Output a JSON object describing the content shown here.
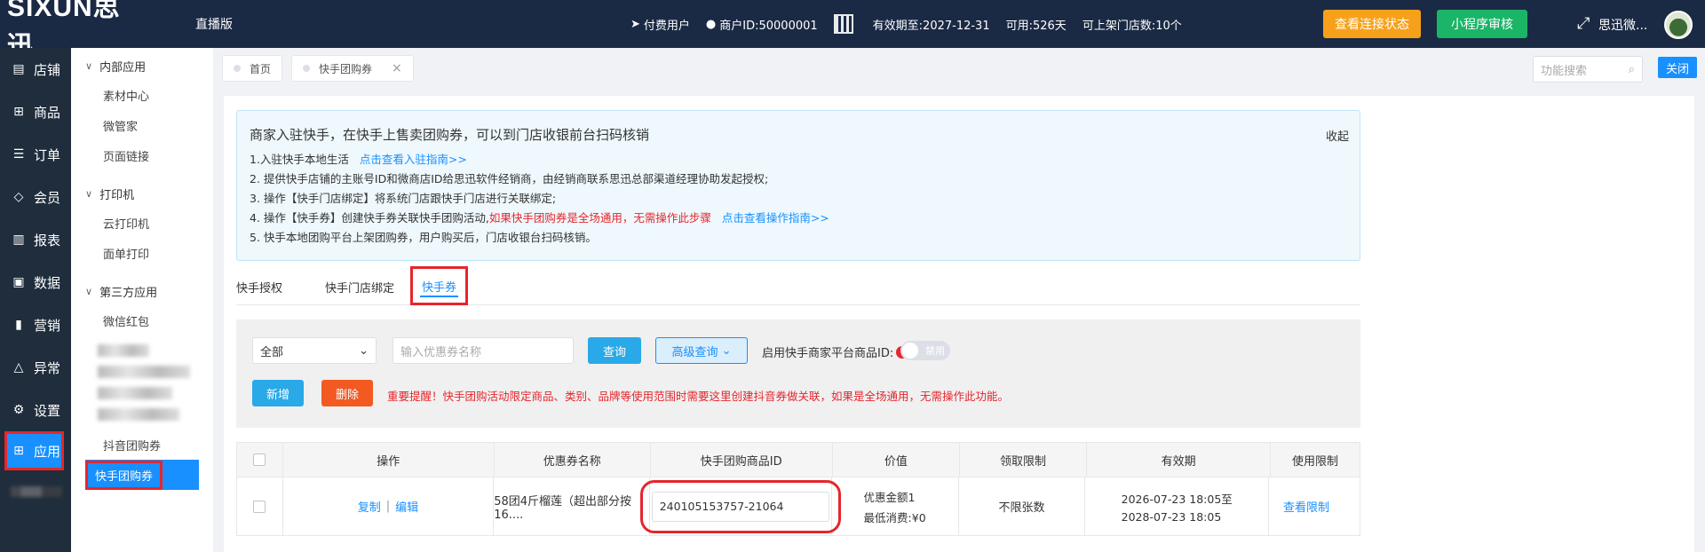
{
  "topbar": {
    "logo": "SIXUN思迅",
    "edition": "直播版",
    "paid_user": "付费用户",
    "merchant_id": "商户ID:50000001",
    "valid_until": "有效期至:2027-12-31",
    "available": "可用:526天",
    "store_count": "可上架门店数:10个",
    "check_status_btn": "查看连接状态",
    "miniapp_btn": "小程序审核",
    "user_name": "思迅微...",
    "accent_orange": "#f7a11a",
    "accent_green": "#1bb567"
  },
  "nav": {
    "items": [
      {
        "label": "店铺",
        "icon": "store-icon"
      },
      {
        "label": "商品",
        "icon": "gift-icon"
      },
      {
        "label": "订单",
        "icon": "order-icon"
      },
      {
        "label": "会员",
        "icon": "diamond-icon"
      },
      {
        "label": "报表",
        "icon": "report-icon"
      },
      {
        "label": "数据",
        "icon": "data-icon"
      },
      {
        "label": "营销",
        "icon": "marketing-icon"
      },
      {
        "label": "异常",
        "icon": "warning-icon"
      },
      {
        "label": "设置",
        "icon": "gear-icon"
      },
      {
        "label": "应用",
        "icon": "apps-icon"
      }
    ]
  },
  "subnav": {
    "group1": "内部应用",
    "g1_items": [
      "素材中心",
      "微管家",
      "页面链接"
    ],
    "group2": "打印机",
    "g2_items": [
      "云打印机",
      "面单打印"
    ],
    "group3": "第三方应用",
    "g3_item1": "微信红包",
    "g3_item_douyin": "抖音团购券",
    "g3_item_active": "快手团购券"
  },
  "tabs": {
    "home": "首页",
    "current": "快手团购券",
    "close_x": "×",
    "search_placeholder": "功能搜索",
    "close_btn": "关闭"
  },
  "notice": {
    "title": "商家入驻快手，在快手上售卖团购券，可以到门店收银前台扫码核销",
    "fold": "收起",
    "line1": "1.入驻快手本地生活",
    "line1_link": "点击查看入驻指南>>",
    "line2": "2. 提供快手店铺的主账号ID和微商店ID给思迅软件经销商，由经销商联系思迅总部渠道经理协助发起授权;",
    "line3": "3. 操作【快手门店绑定】将系统门店跟快手门店进行关联绑定;",
    "line4a": "4. 操作【快手券】创建快手券关联快手团购活动,",
    "line4_red": "如果快手团购券是全场通用，无需操作此步骤",
    "line4_link": "点击查看操作指南>>",
    "line5": "5. 快手本地团购平台上架团购券，用户购买后，门店收银台扫码核销。"
  },
  "subtabs": [
    "快手授权",
    "快手门店绑定",
    "快手券"
  ],
  "filter": {
    "select_value": "全部",
    "coupon_placeholder": "输入优惠券名称",
    "query_btn": "查询",
    "advanced_btn": "高级查询",
    "enable_label": "启用快手商家平台商品ID:",
    "toggle_label": "禁用",
    "add_btn": "新增",
    "delete_btn": "删除",
    "warning": "重要提醒！快手团购活动限定商品、类别、品牌等使用范围时需要这里创建抖音券做关联，如果是全场通用，无需操作此功能。"
  },
  "table": {
    "headers": [
      "操作",
      "优惠券名称",
      "快手团购商品ID",
      "价值",
      "领取限制",
      "有效期",
      "使用限制"
    ],
    "rows": [
      {
        "copy": "复制",
        "edit": "编辑",
        "name": "58团4斤榴莲（超出部分按16....",
        "product_id": "240105153757-21064",
        "value_line1": "优惠金额1",
        "value_line2": "最低消费:¥0",
        "limit": "不限张数",
        "valid_line1": "2026-07-23 18:05至",
        "valid_line2": "2028-07-23 18:05",
        "usage": "查看限制"
      }
    ]
  }
}
